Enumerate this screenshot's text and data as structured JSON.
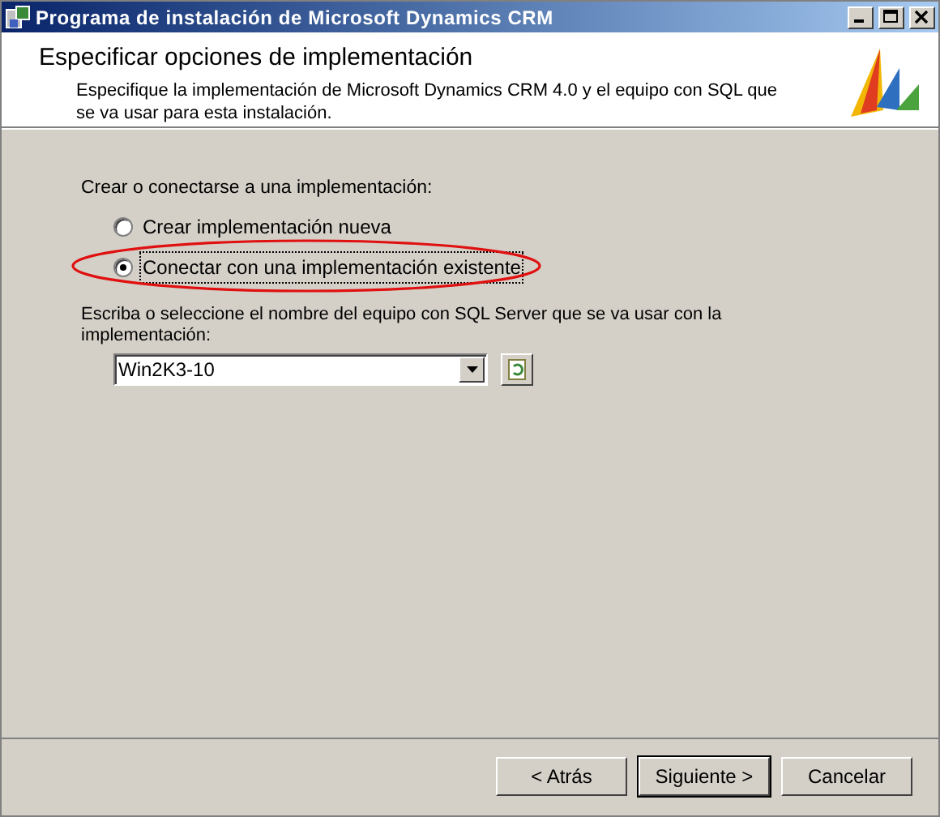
{
  "window": {
    "title": "Programa de instalación de Microsoft Dynamics CRM"
  },
  "header": {
    "title": "Especificar opciones de implementación",
    "description": "Especifique la implementación de Microsoft Dynamics CRM 4.0 y el equipo con SQL que se va usar para esta instalación."
  },
  "deployment": {
    "label": "Crear o conectarse a una implementación:",
    "options": [
      {
        "label": "Crear implementación nueva",
        "selected": false
      },
      {
        "label": "Conectar con una implementación existente",
        "selected": true
      }
    ]
  },
  "server": {
    "label": "Escriba o seleccione el nombre del equipo con SQL Server que se va usar con la implementación:",
    "value": "Win2K3-10"
  },
  "buttons": [
    {
      "label": "< Atrás",
      "default": false
    },
    {
      "label": "Siguiente >",
      "default": true
    },
    {
      "label": "Cancelar",
      "default": false
    }
  ]
}
